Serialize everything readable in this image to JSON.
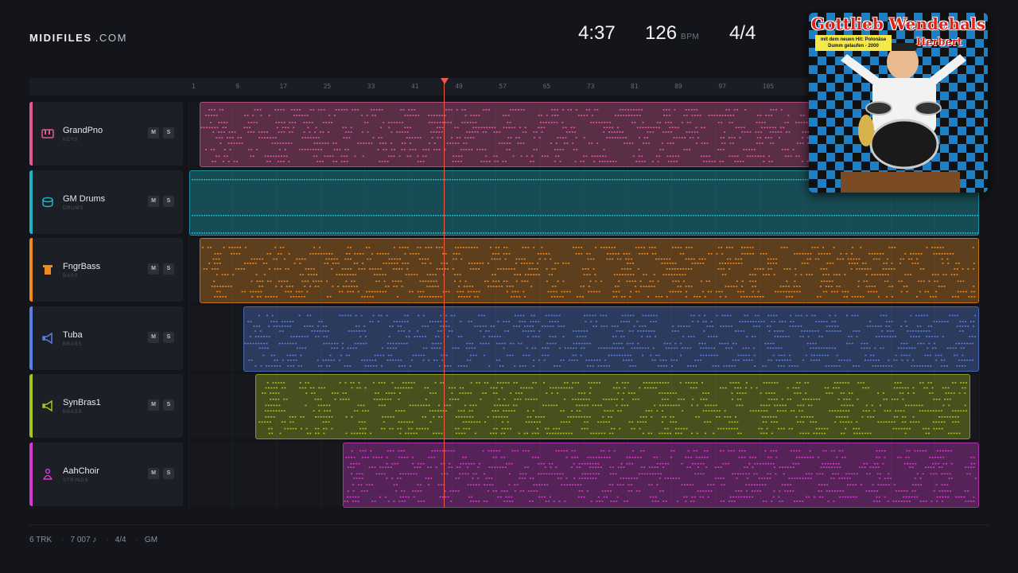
{
  "brand": {
    "name": "MIDIFILES",
    "domain": ".COM"
  },
  "transport": {
    "time": "4:37",
    "bpm": "126",
    "bpm_unit": "BPM",
    "signature": "4/4"
  },
  "ruler": {
    "ticks": [
      "1",
      "9",
      "17",
      "25",
      "33",
      "41",
      "49",
      "57",
      "65",
      "73",
      "81",
      "89",
      "97",
      "105",
      "",
      "",
      "",
      "",
      "",
      "",
      "",
      "",
      ""
    ]
  },
  "tracks": [
    {
      "name": "GrandPno",
      "category": "KEYS",
      "color": "#e05a98",
      "icon": "piano-icon",
      "mute": "M",
      "solo": "S"
    },
    {
      "name": "GM Drums",
      "category": "DRUMS",
      "color": "#1fb3c4",
      "icon": "drum-icon",
      "mute": "M",
      "solo": "S"
    },
    {
      "name": "FngrBass",
      "category": "BASS",
      "color": "#ee8a1e",
      "icon": "bass-icon",
      "mute": "M",
      "solo": "S"
    },
    {
      "name": "Tuba",
      "category": "BRASS",
      "color": "#5b7fe0",
      "icon": "horn-icon",
      "mute": "M",
      "solo": "S"
    },
    {
      "name": "SynBras1",
      "category": "BRASS",
      "color": "#a8c21e",
      "icon": "horn-icon",
      "mute": "M",
      "solo": "S"
    },
    {
      "name": "AahChoir",
      "category": "STRINGS",
      "color": "#d938d0",
      "icon": "choir-icon",
      "mute": "M",
      "solo": "S"
    }
  ],
  "footer": {
    "tracks": "6 TRK",
    "notes": "7 007 ♪",
    "signature": "4/4",
    "standard": "GM"
  },
  "cover": {
    "artist": "Gottlieb Wendehals",
    "sticker": "mit dem neuen Hit: Polonäse Dumm gelaufen - 2000",
    "title": "Herbert"
  }
}
